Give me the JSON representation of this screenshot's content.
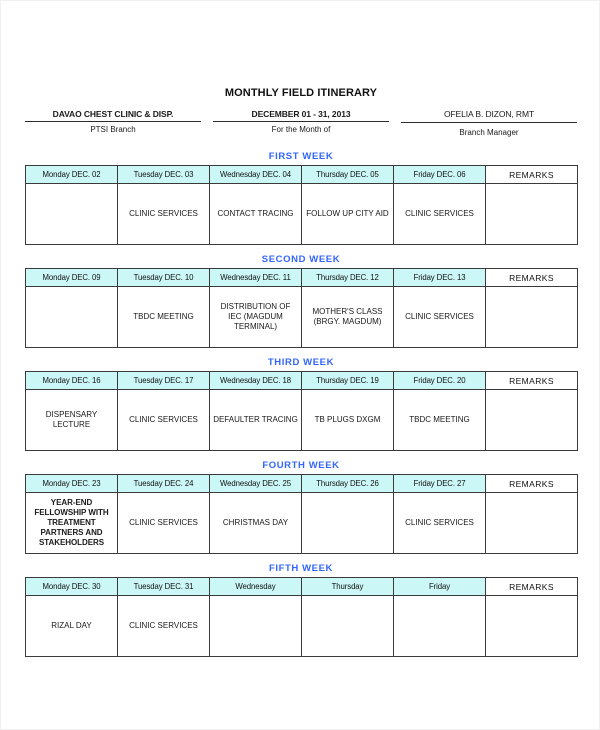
{
  "document": {
    "title": "MONTHLY FIELD ITINERARY"
  },
  "header": {
    "left": {
      "top": "DAVAO CHEST CLINIC & DISP.",
      "sub": "PTSI Branch"
    },
    "center": {
      "top": "DECEMBER 01 - 31, 2013",
      "sub": "For the Month of"
    },
    "right": {
      "top": "OFELIA B. DIZON, RMT",
      "sub": "Branch Manager"
    }
  },
  "colors": {
    "week_label": "#3366ff",
    "header_cell_bg": "#ccf7f7",
    "holiday_red": "#fa3c3c",
    "holiday_rust": "#c0531f",
    "grid_line": "#3a3a3a"
  },
  "remarks_header": "REMARKS",
  "weeks": [
    {
      "label": "FIRST  WEEK",
      "days": [
        {
          "header": "Monday DEC. 02",
          "activity": ""
        },
        {
          "header": "Tuesday DEC. 03",
          "activity": "CLINIC SERVICES"
        },
        {
          "header": "Wednesday DEC. 04",
          "activity": "CONTACT TRACING"
        },
        {
          "header": "Thursday DEC. 05",
          "activity": "FOLLOW UP CITY AID"
        },
        {
          "header": "Friday DEC. 06",
          "activity": "CLINIC SERVICES"
        }
      ],
      "remarks": ""
    },
    {
      "label": "SECOND  WEEK",
      "days": [
        {
          "header": "Monday DEC. 09",
          "activity": ""
        },
        {
          "header": "Tuesday DEC. 10",
          "activity": "TBDC MEETING"
        },
        {
          "header": "Wednesday DEC. 11",
          "activity": "DISTRIBUTION OF IEC (MAGDUM TERMINAL)"
        },
        {
          "header": "Thursday DEC. 12",
          "activity": "MOTHER'S CLASS (BRGY. MAGDUM)"
        },
        {
          "header": "Friday DEC. 13",
          "activity": "CLINIC SERVICES"
        }
      ],
      "remarks": ""
    },
    {
      "label": "THIRD  WEEK",
      "days": [
        {
          "header": "Monday DEC. 16",
          "activity": "DISPENSARY LECTURE"
        },
        {
          "header": "Tuesday DEC. 17",
          "activity": "CLINIC SERVICES"
        },
        {
          "header": "Wednesday DEC. 18",
          "activity": "DEFAULTER TRACING"
        },
        {
          "header": "Thursday DEC. 19",
          "activity": "TB PLUGS DXGM"
        },
        {
          "header": "Friday DEC. 20",
          "activity": "TBDC MEETING"
        }
      ],
      "remarks": ""
    },
    {
      "label": "FOURTH  WEEK",
      "days": [
        {
          "header": "Monday DEC. 23",
          "activity": "YEAR-END FELLOWSHIP WITH TREATMENT PARTNERS AND STAKEHOLDERS",
          "style": "small"
        },
        {
          "header": "Tuesday DEC. 24",
          "activity": "CLINIC SERVICES"
        },
        {
          "header": "Wednesday DEC. 25",
          "activity": "CHRISTMAS DAY",
          "style": "red"
        },
        {
          "header": "Thursday DEC. 26",
          "activity": ""
        },
        {
          "header": "Friday DEC. 27",
          "activity": "CLINIC SERVICES"
        }
      ],
      "remarks": ""
    },
    {
      "label": "FIFTH  WEEK",
      "days": [
        {
          "header": "Monday DEC. 30",
          "activity": "RIZAL DAY",
          "style": "rust"
        },
        {
          "header": "Tuesday DEC. 31",
          "activity": "CLINIC SERVICES"
        },
        {
          "header": "Wednesday",
          "activity": ""
        },
        {
          "header": "Thursday",
          "activity": ""
        },
        {
          "header": "Friday",
          "activity": ""
        }
      ],
      "remarks": ""
    }
  ]
}
